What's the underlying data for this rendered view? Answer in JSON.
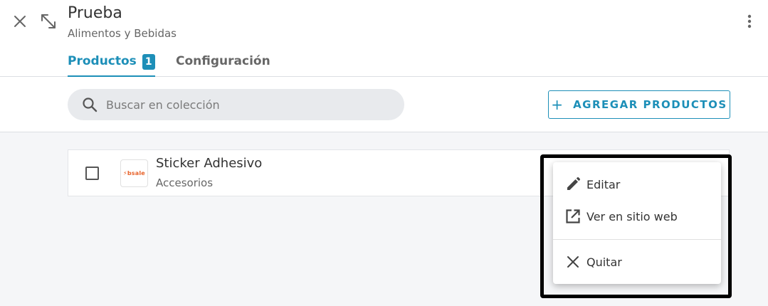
{
  "collection": {
    "title": "Prueba",
    "subtitle": "Alimentos y Bebidas"
  },
  "tabs": [
    {
      "label": "Productos",
      "badge": "1",
      "active": true
    },
    {
      "label": "Configuración",
      "active": false
    }
  ],
  "toolbar": {
    "search_placeholder": "Buscar en colección",
    "add_button_label": "AGREGAR PRODUCTOS",
    "add_button_icon": "+"
  },
  "products": [
    {
      "name": "Sticker Adhesivo",
      "category": "Accesorios",
      "thumbnail_logo": "bsale",
      "checked": false
    }
  ],
  "context_menu": {
    "items": [
      {
        "label": "Editar",
        "icon": "pencil-icon"
      },
      {
        "label": "Ver en sitio web",
        "icon": "external-link-icon"
      },
      {
        "label": "Quitar",
        "icon": "close-icon"
      }
    ]
  },
  "colors": {
    "accent": "#1d8fb8",
    "logo": "#e8632b",
    "highlight_border": "#000000"
  }
}
